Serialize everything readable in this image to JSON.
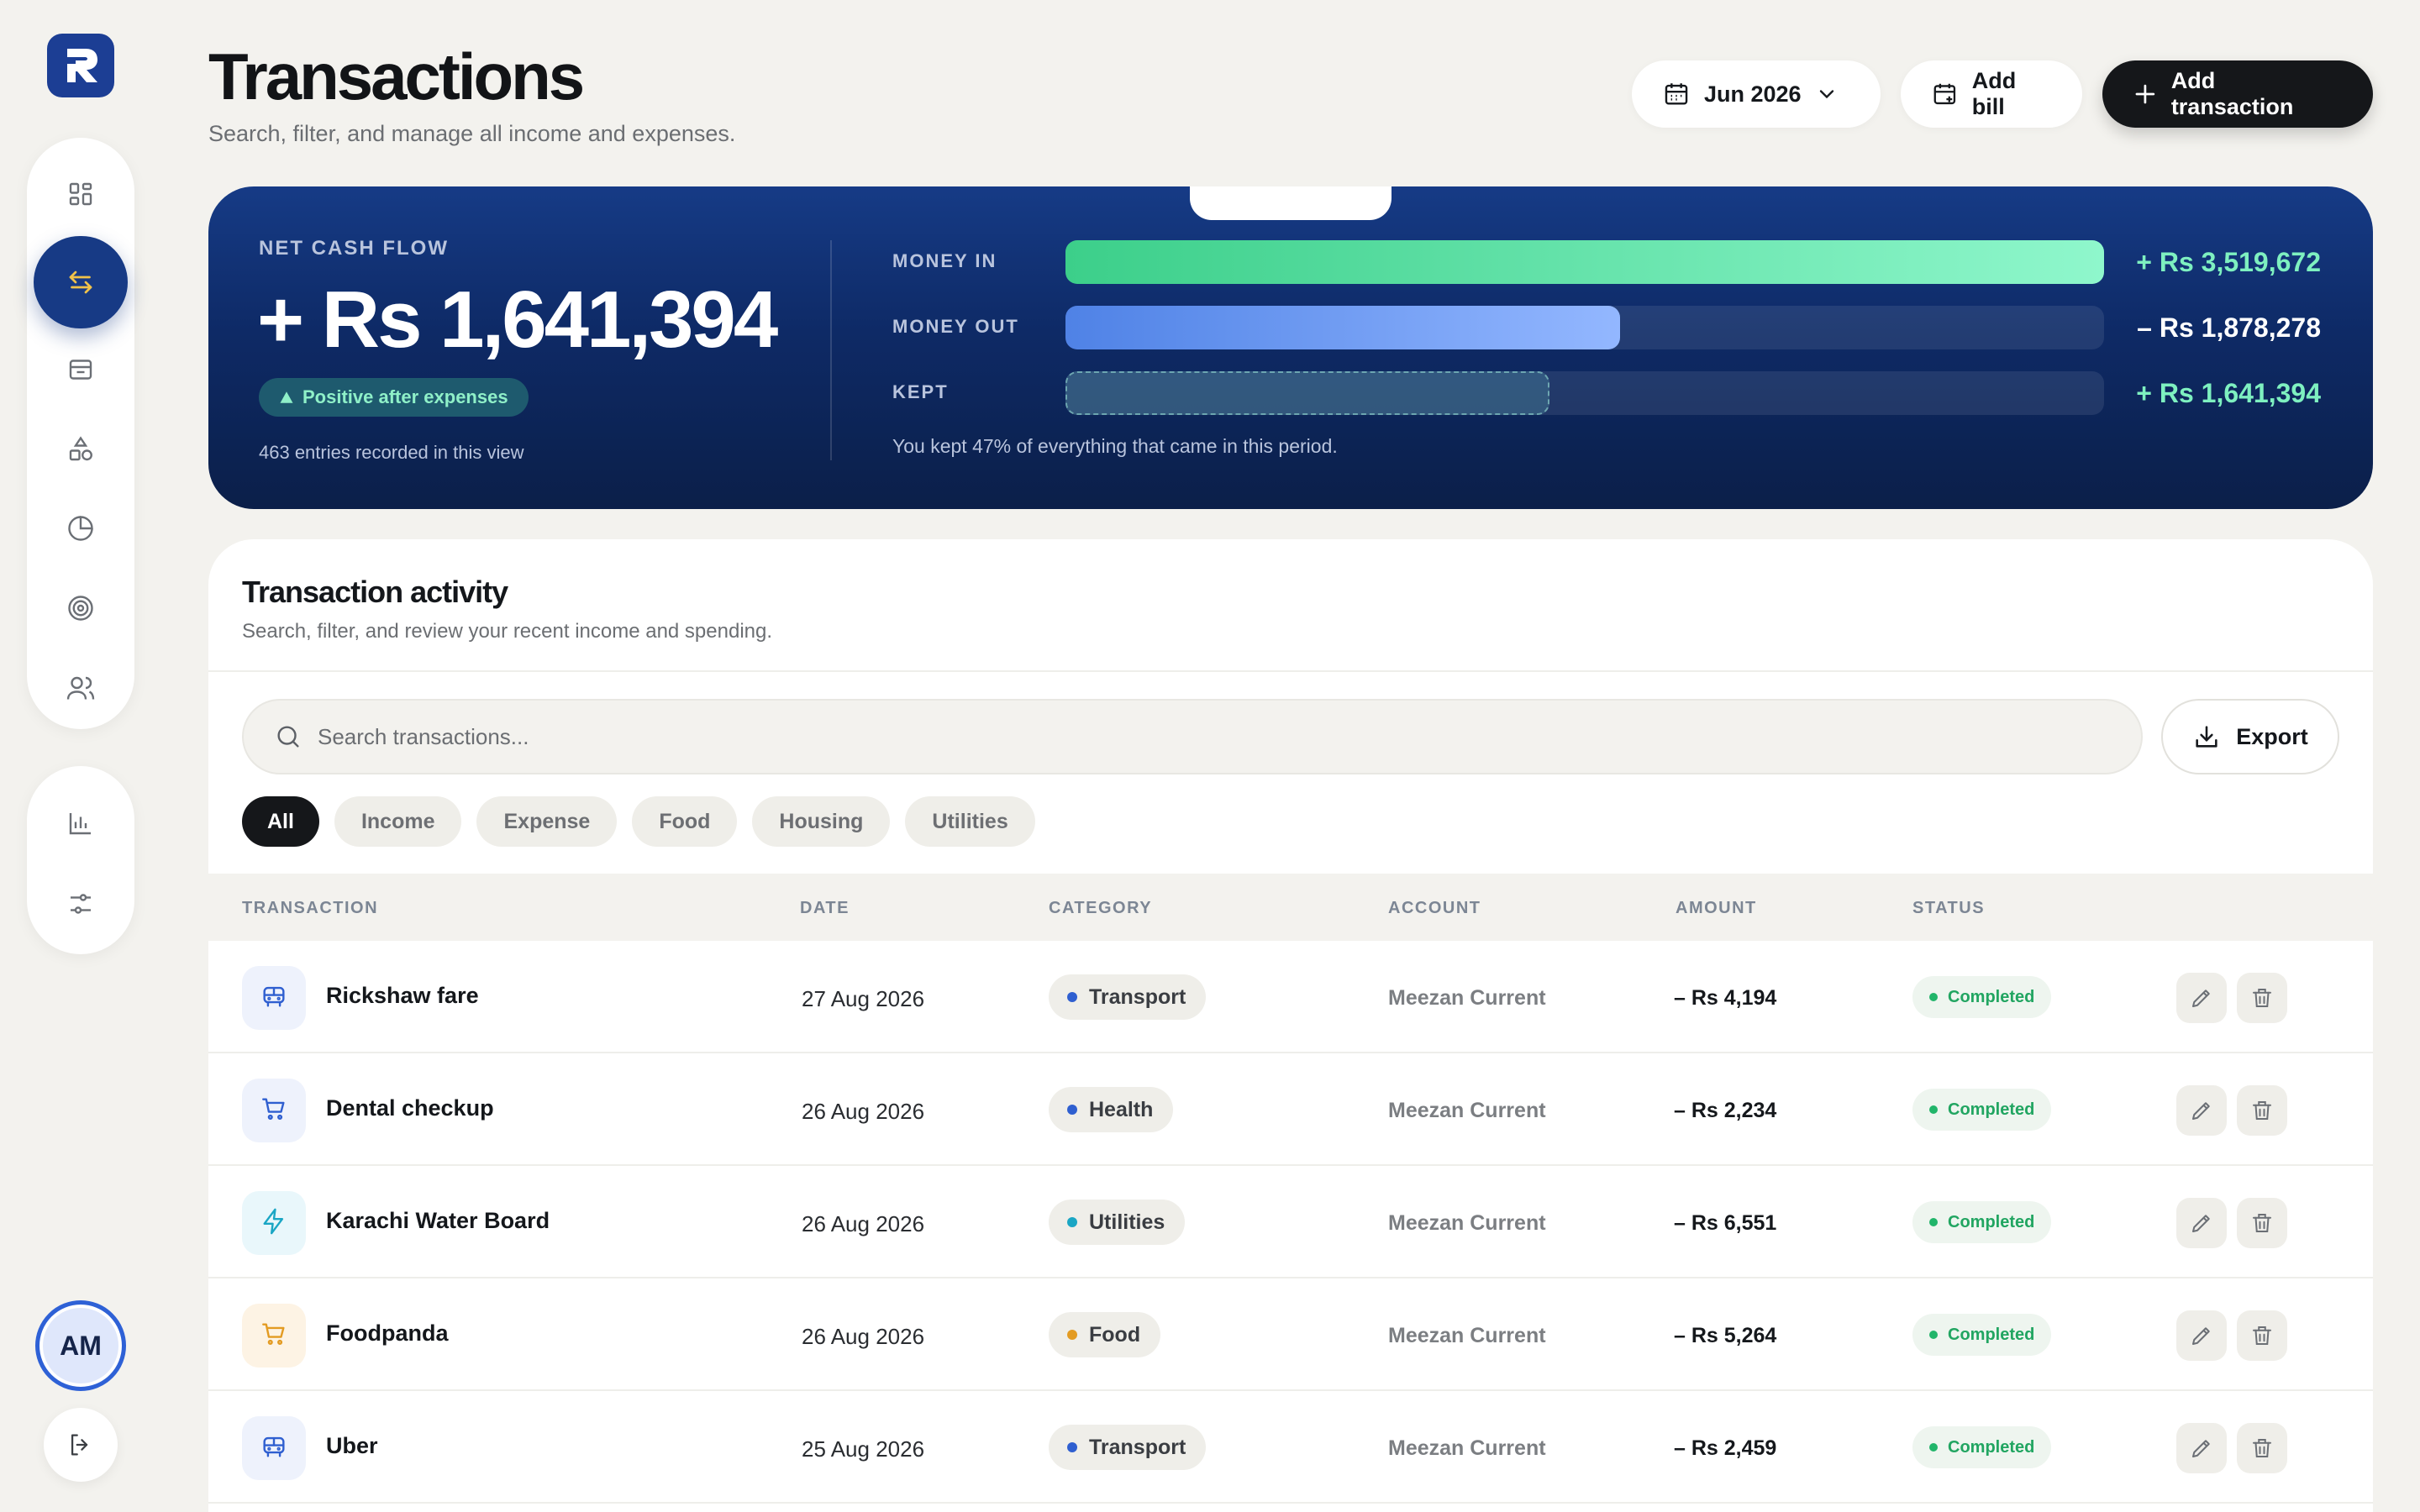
{
  "brand": {
    "logo_letter": "R",
    "accent": "#1c3e94"
  },
  "sidebar": {
    "primary": [
      {
        "icon": "grid-icon",
        "name": "dashboard"
      },
      {
        "icon": "transfer-arrows-icon",
        "name": "transactions",
        "active": true
      },
      {
        "icon": "inbox-icon",
        "name": "inbox"
      },
      {
        "icon": "shapes-icon",
        "name": "categories"
      },
      {
        "icon": "pie-chart-icon",
        "name": "budgets"
      },
      {
        "icon": "target-icon",
        "name": "goals"
      },
      {
        "icon": "users-icon",
        "name": "people"
      }
    ],
    "secondary": [
      {
        "icon": "bar-chart-icon",
        "name": "reports"
      },
      {
        "icon": "sliders-icon",
        "name": "settings"
      }
    ],
    "avatar_initials": "AM"
  },
  "header": {
    "title": "Transactions",
    "subtitle": "Search, filter, and manage all income and expenses.",
    "month": "Jun 2026",
    "add_bill": "Add bill",
    "add_transaction": "Add transaction"
  },
  "cashflow": {
    "net_label": "NET CASH FLOW",
    "net_value": "+ Rs 1,641,394",
    "badge": "Positive after expenses",
    "entries_note": "463 entries recorded in this view",
    "rows": [
      {
        "label": "MONEY IN",
        "value": "+ Rs 3,519,672",
        "fraction": 1.0
      },
      {
        "label": "MONEY OUT",
        "value": "– Rs 1,878,278",
        "fraction": 0.534
      },
      {
        "label": "KEPT",
        "value": "+ Rs 1,641,394",
        "fraction": 0.466
      }
    ],
    "note": "You kept 47% of everything that came in this period.",
    "colors": {
      "positive": "#7ef0c0",
      "in_bar": "#3ccf8a",
      "out_bar": "#4f82e6"
    }
  },
  "activity": {
    "title": "Transaction activity",
    "subtitle": "Search, filter, and review your recent income and spending.",
    "search_placeholder": "Search transactions...",
    "export_label": "Export",
    "filters": [
      "All",
      "Income",
      "Expense",
      "Food",
      "Housing",
      "Utilities"
    ],
    "active_filter": "All",
    "columns": [
      "TRANSACTION",
      "DATE",
      "CATEGORY",
      "ACCOUNT",
      "AMOUNT",
      "STATUS"
    ],
    "rows": [
      {
        "name": "Rickshaw fare",
        "date": "27 Aug 2026",
        "category": "Transport",
        "account": "Meezan Current",
        "amount": "– Rs 4,194",
        "status": "Completed",
        "icon": "bus-icon",
        "icon_bg": "#eef2fc",
        "icon_color": "#2f5fd0",
        "dot": "#2f5fd0"
      },
      {
        "name": "Dental checkup",
        "date": "26 Aug 2026",
        "category": "Health",
        "account": "Meezan Current",
        "amount": "– Rs 2,234",
        "status": "Completed",
        "icon": "cart-icon",
        "icon_bg": "#eef2fc",
        "icon_color": "#2f5fd0",
        "dot": "#2f5fd0"
      },
      {
        "name": "Karachi Water Board",
        "date": "26 Aug 2026",
        "category": "Utilities",
        "account": "Meezan Current",
        "amount": "– Rs 6,551",
        "status": "Completed",
        "icon": "bolt-icon",
        "icon_bg": "#e9f7fb",
        "icon_color": "#1aa6c4",
        "dot": "#1aa6c4"
      },
      {
        "name": "Foodpanda",
        "date": "26 Aug 2026",
        "category": "Food",
        "account": "Meezan Current",
        "amount": "– Rs 5,264",
        "status": "Completed",
        "icon": "cart-icon",
        "icon_bg": "#fdf3e4",
        "icon_color": "#e39b22",
        "dot": "#e39b22"
      },
      {
        "name": "Uber",
        "date": "25 Aug 2026",
        "category": "Transport",
        "account": "Meezan Current",
        "amount": "– Rs 2,459",
        "status": "Completed",
        "icon": "bus-icon",
        "icon_bg": "#eef2fc",
        "icon_color": "#2f5fd0",
        "dot": "#2f5fd0"
      }
    ]
  }
}
